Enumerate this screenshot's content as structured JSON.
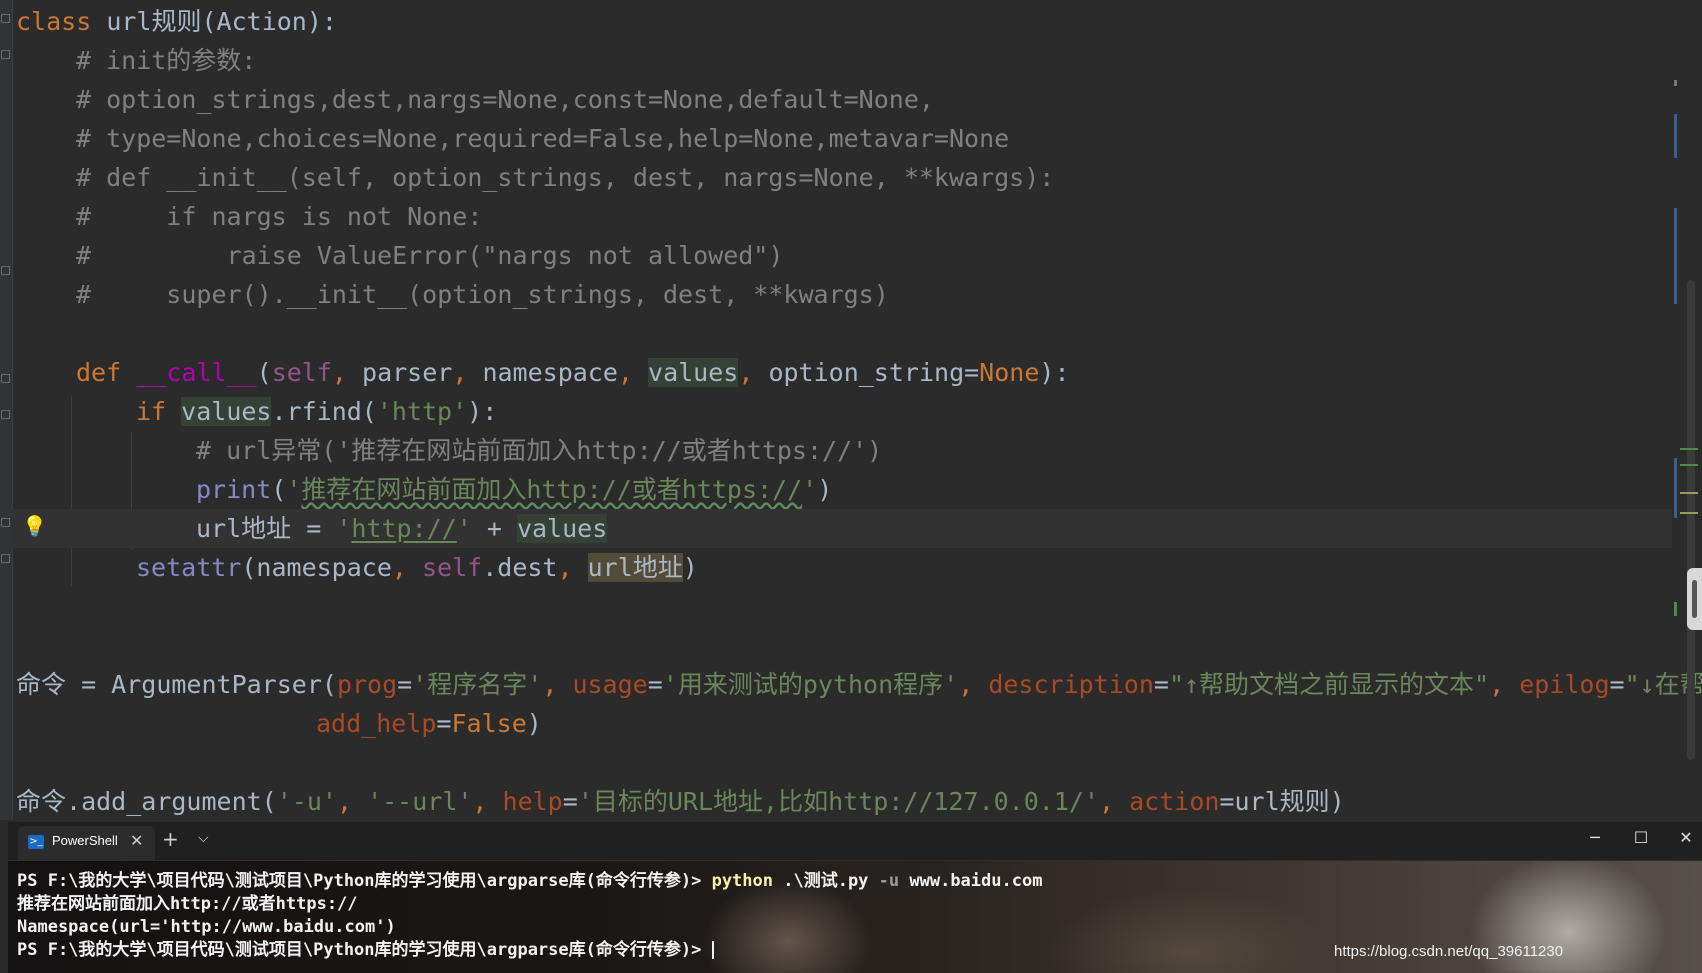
{
  "editor": {
    "line1": {
      "kw": "class",
      "name": "url规则",
      "open": "(",
      "base": "Action",
      "close": "):"
    },
    "line2": "# init的参数:",
    "line3": "# option_strings,dest,nargs=None,const=None,default=None,",
    "line4": "# type=None,choices=None,required=False,help=None,metavar=None",
    "line5": "# def __init__(self, option_strings, dest, nargs=None, **kwargs):",
    "line6": "#     if nargs is not None:",
    "line7": "#         raise ValueError(\"nargs not allowed\")",
    "line8": "#     super().__init__(option_strings, dest, **kwargs)",
    "line9": {
      "kw": "def",
      "name": "__call__",
      "open": "(",
      "self": "self",
      "c1": ", ",
      "p1": "parser",
      "c2": ", ",
      "p2": "namespace",
      "c3": ", ",
      "p3": "values",
      "c4": ", ",
      "p4": "option_string=",
      "none": "None",
      "close": "):"
    },
    "line10": {
      "kw": "if",
      "var": "values",
      "rest": ".rfind(",
      "str": "'http'",
      "close": "):"
    },
    "line11": "# url异常('推荐在网站前面加入http://或者https://')",
    "line12": {
      "fn": "print",
      "open": "(",
      "q1": "'",
      "str": "推荐在网站前面加入http://或者https://",
      "q2": "'",
      "close": ")"
    },
    "line13": {
      "var": "url地址",
      "eq": " = ",
      "q1": "'",
      "str": "http://",
      "q2": "'",
      "plus": " + ",
      "val": "values"
    },
    "line14": {
      "fn": "setattr",
      "open": "(",
      "p1": "namespace",
      "c1": ", ",
      "self": "self",
      "dest": ".dest",
      "c2": ", ",
      "var": "url地址",
      "close": ")"
    },
    "line15": {
      "var": "命令",
      "eq": " = ",
      "call": "ArgumentParser(",
      "k1": "prog",
      "e1": "=",
      "s1": "'程序名字'",
      "c1": ", ",
      "k2": "usage",
      "e2": "=",
      "s2": "'用来测试的python程序'",
      "c2": ", ",
      "k3": "description",
      "e3": "=",
      "s3": "\"↑帮助文档之前显示的文本\"",
      "c3": ", ",
      "k4": "epilog",
      "e4": "=",
      "s4": "\"↓在帮"
    },
    "line16": {
      "k": "add_help",
      "e": "=",
      "v": "False",
      "close": ")"
    },
    "line17": {
      "var": "命令",
      "call": ".add_argument(",
      "s1": "'-u'",
      "c1": ", ",
      "s2": "'--url'",
      "c2": ", ",
      "k1": "help",
      "e1": "=",
      "s3": "'目标的URL地址,比如http://127.0.0.1/'",
      "c3": ", ",
      "k2": "action",
      "e2": "=",
      "v": "url规则",
      "close": ")"
    }
  },
  "terminal": {
    "tab_title": "PowerShell",
    "tab_close": "✕",
    "tab_add": "+",
    "tab_dropdown": "⌵",
    "win_minimize": "─",
    "win_maximize": "☐",
    "win_close": "✕",
    "prompt1": "PS F:\\我的大学\\项目代码\\测试项目\\Python库的学习使用\\argparse库(命令行传参)> ",
    "cmd": "python",
    "cmd_arg1": " .\\测试.py ",
    "cmd_flag": "-u",
    "cmd_arg2": " www.baidu.com",
    "out1": "推荐在网站前面加入http://或者https://",
    "out2": "Namespace(url='http://www.baidu.com')",
    "prompt2": "PS F:\\我的大学\\项目代码\\测试项目\\Python库的学习使用\\argparse库(命令行传参)> ",
    "watermark": "https://blog.csdn.net/qq_39611230"
  },
  "icons": {
    "bulb": "💡"
  }
}
